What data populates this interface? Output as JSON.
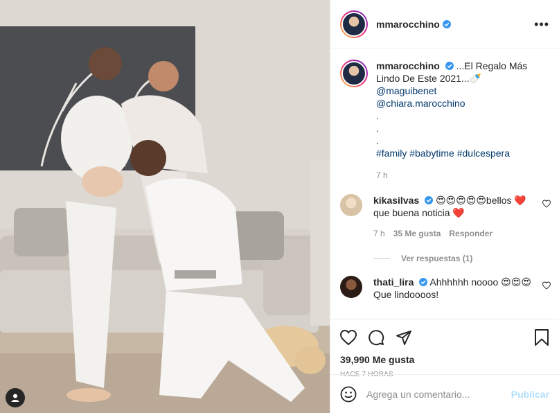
{
  "post": {
    "username": "mmarocchino",
    "more_label": "•••"
  },
  "caption": {
    "username": "mmarocchino",
    "text": "...El Regalo Más Lindo De Este 2021...🍼",
    "mentions": [
      "@maguibenet",
      "@chiara.marocchino"
    ],
    "dots": [
      ".",
      ".",
      "."
    ],
    "hashtags": "#family #babytime #dulcespera",
    "time": "7 h"
  },
  "comments": [
    {
      "username": "kikasilvas",
      "text": "😍😍😍😍😍bellos ❤️ que buena noticia ❤️",
      "time": "7 h",
      "likes": "35 Me gusta",
      "reply": "Responder",
      "view_replies": "Ver respuestas (1)"
    },
    {
      "username": "thati_lira",
      "text": "Ahhhhhh noooo 😍😍😍 Que lindoooos!"
    }
  ],
  "stats": {
    "likes": "39,990 Me gusta",
    "ago": "HACE 7 HORAS"
  },
  "add_comment": {
    "placeholder": "Agrega un comentario...",
    "post_label": "Publicar"
  },
  "colors": {
    "verified": "#3897f0",
    "link": "#00376b",
    "heart_red": "#ed4956",
    "publish_disabled": "#b2dffc"
  }
}
